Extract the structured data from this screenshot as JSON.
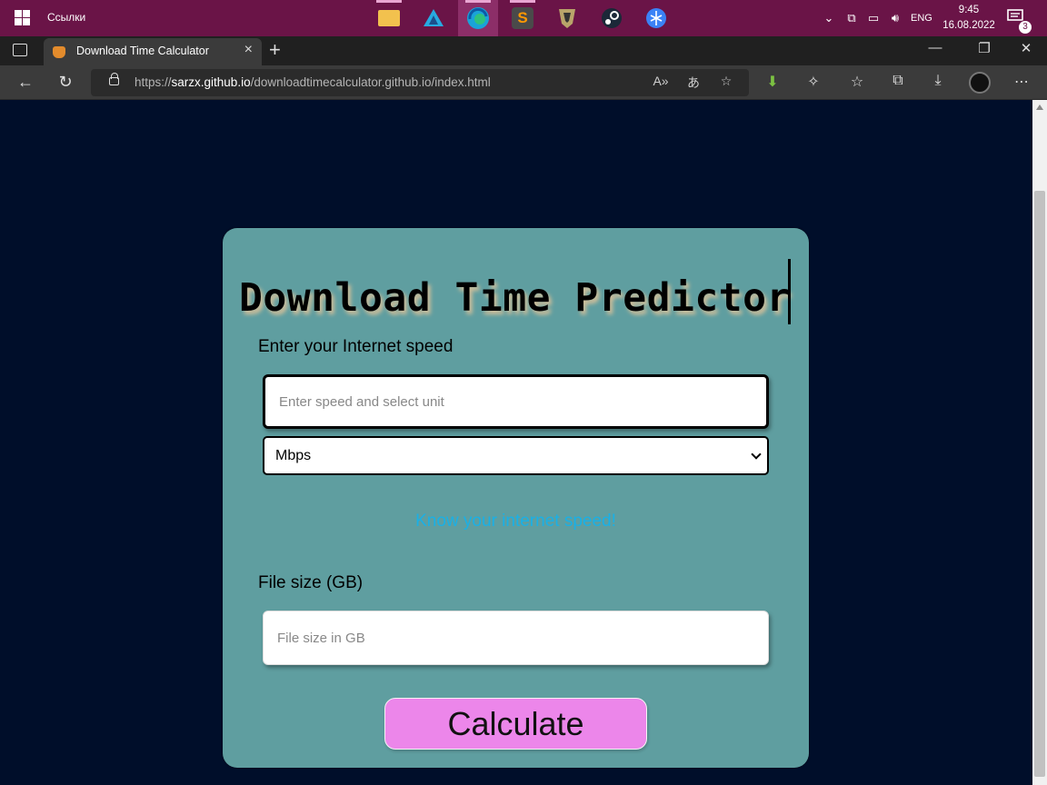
{
  "taskbar": {
    "links_label": "Ссылки",
    "apps": [
      "file-explorer",
      "affinity",
      "edge",
      "sublime-text",
      "game-launcher",
      "steam",
      "network-app"
    ],
    "language": "ENG",
    "time": "9:45",
    "date": "16.08.2022",
    "notification_count": "3"
  },
  "browser": {
    "tab_title": "Download Time Calculator",
    "url_prefix": "https://",
    "url_host": "sarzx.github.io",
    "url_path": "/downloadtimecalculator.github.io/index.html"
  },
  "page": {
    "title": "Download Time Predictor",
    "speed_label": "Enter your Internet speed",
    "speed_placeholder": "Enter speed and select unit",
    "unit_selected": "Mbps",
    "speed_link": "Know your internet speed!",
    "size_label": "File size (GB)",
    "size_placeholder": "File size in GB",
    "calculate_label": "Calculate"
  },
  "colors": {
    "taskbar": "#6a1447",
    "page_bg": "#000e2a",
    "card": "#5f9ea0",
    "link": "#1ab0e6",
    "button": "#ec86ea"
  }
}
